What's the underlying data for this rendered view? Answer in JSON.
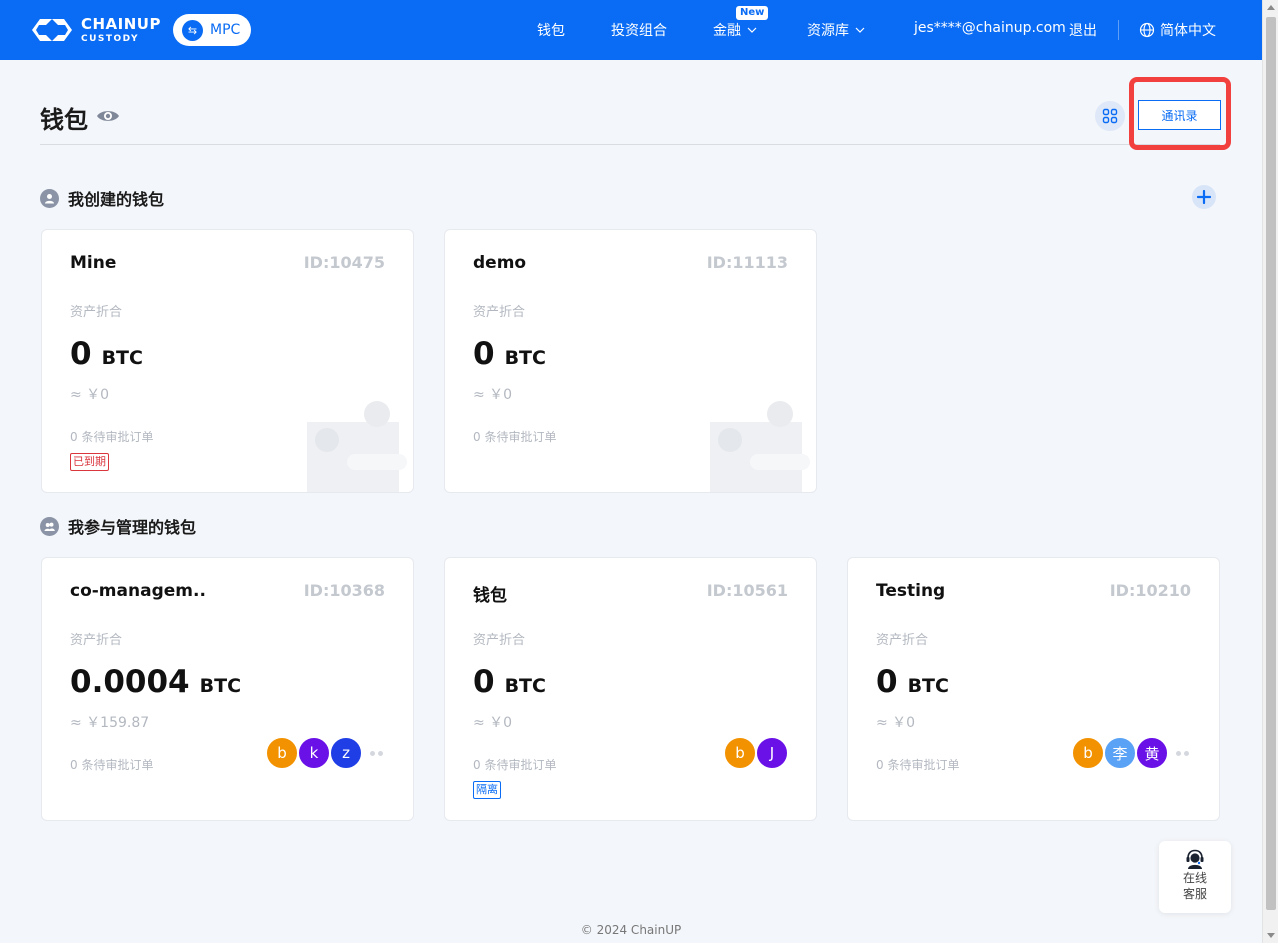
{
  "header": {
    "logo": {
      "line1": "CHAINUP",
      "line2": "CUSTODY"
    },
    "mode_badge": "MPC",
    "nav": [
      {
        "label": "钱包"
      },
      {
        "label": "投资组合"
      },
      {
        "label": "金融",
        "badge": "New"
      },
      {
        "label": "资源库"
      }
    ],
    "user_email": "jes****@chainup.com",
    "logout": "退出",
    "language": "简体中文"
  },
  "page": {
    "title": "钱包",
    "contacts_button": "通讯录"
  },
  "sections": {
    "mine": {
      "title": "我创建的钱包"
    },
    "managed": {
      "title": "我参与管理的钱包"
    }
  },
  "card_common": {
    "asset_label": "资产折合",
    "unit": "BTC"
  },
  "wallets_mine": [
    {
      "name": "Mine",
      "id": "ID:10475",
      "amount": "0",
      "fiat": "≈ ￥0",
      "pending": "0 条待审批订单",
      "tag": "已到期"
    },
    {
      "name": "demo",
      "id": "ID:11113",
      "amount": "0",
      "fiat": "≈ ￥0",
      "pending": "0 条待审批订单"
    }
  ],
  "wallets_managed": [
    {
      "name": "co-managem..",
      "id": "ID:10368",
      "amount": "0.0004",
      "fiat": "≈ ￥159.87",
      "pending": "0 条待审批订单",
      "avatars": [
        "b",
        "k",
        "z"
      ]
    },
    {
      "name": "钱包",
      "id": "ID:10561",
      "amount": "0",
      "fiat": "≈ ￥0",
      "pending": "0 条待审批订单",
      "tag": "隔离",
      "avatars": [
        "b",
        "J"
      ]
    },
    {
      "name": "Testing",
      "id": "ID:10210",
      "amount": "0",
      "fiat": "≈ ￥0",
      "pending": "0 条待审批订单",
      "avatars": [
        "b",
        "李",
        "黄"
      ]
    }
  ],
  "colors": {
    "brand": "#0a6cf4",
    "avatar_orange": "#f39200",
    "avatar_purple": "#6a11e8",
    "avatar_blue": "#1f3ee6",
    "avatar_lightblue": "#5aa2f5",
    "expired_tag": "#d9363e",
    "highlight": "#f2403f"
  },
  "support": {
    "label": "在线客服"
  },
  "footer": "© 2024 ChainUP"
}
